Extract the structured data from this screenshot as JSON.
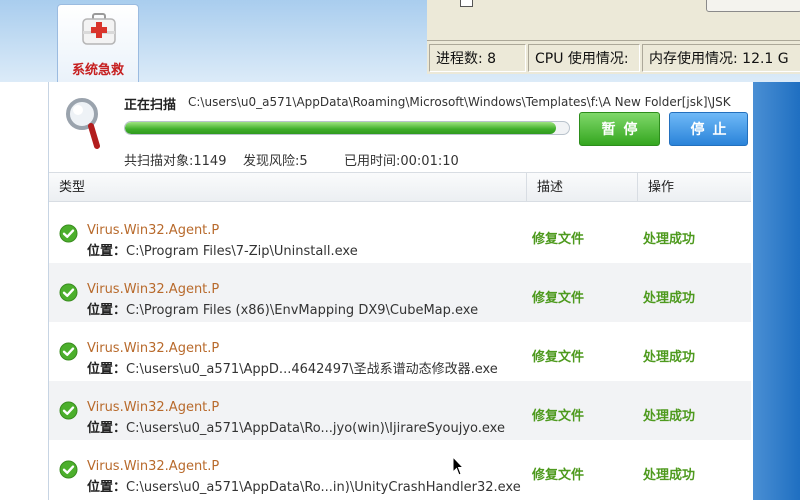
{
  "tab": {
    "label": "系统急救",
    "icon": "first-aid-kit-icon"
  },
  "background_window": {
    "status": {
      "processes": "进程数: 8",
      "cpu": "CPU 使用情况:",
      "memory": "内存使用情况: 12.1 G"
    }
  },
  "scan": {
    "label": "正在扫描",
    "path": "C:\\users\\u0_a571\\AppData\\Roaming\\Microsoft\\Windows\\Templates\\f:\\A New Folder[jsk]\\JSK",
    "progress_percent": 97,
    "pause_label": "暂停",
    "stop_label": "停止",
    "stats": {
      "total": "共扫描对象:1149",
      "risks": "发现风险:5",
      "elapsed": "已用时间:00:01:10"
    }
  },
  "table": {
    "headers": {
      "type": "类型",
      "desc": "描述",
      "op": "操作"
    },
    "location_label": "位置：",
    "rows": [
      {
        "name": "Virus.Win32.Agent.P",
        "path": "C:\\Program Files\\7-Zip\\Uninstall.exe",
        "desc": "修复文件",
        "op": "处理成功"
      },
      {
        "name": "Virus.Win32.Agent.P",
        "path": "C:\\Program Files (x86)\\EnvMapping DX9\\CubeMap.exe",
        "desc": "修复文件",
        "op": "处理成功"
      },
      {
        "name": "Virus.Win32.Agent.P",
        "path": "C:\\users\\u0_a571\\AppD...4642497\\圣战系谱动态修改器.exe",
        "desc": "修复文件",
        "op": "处理成功"
      },
      {
        "name": "Virus.Win32.Agent.P",
        "path": "C:\\users\\u0_a571\\AppData\\Ro...jyo(win)\\IjirareSyoujyo.exe",
        "desc": "修复文件",
        "op": "处理成功"
      },
      {
        "name": "Virus.Win32.Agent.P",
        "path": "C:\\users\\u0_a571\\AppData\\Ro...in)\\UnityCrashHandler32.exe",
        "desc": "修复文件",
        "op": "处理成功"
      }
    ]
  },
  "colors": {
    "accent_green": "#4e9a1e",
    "accent_blue": "#2a83d9",
    "virus_name": "#b86a2c",
    "tab_label": "#c62020"
  }
}
